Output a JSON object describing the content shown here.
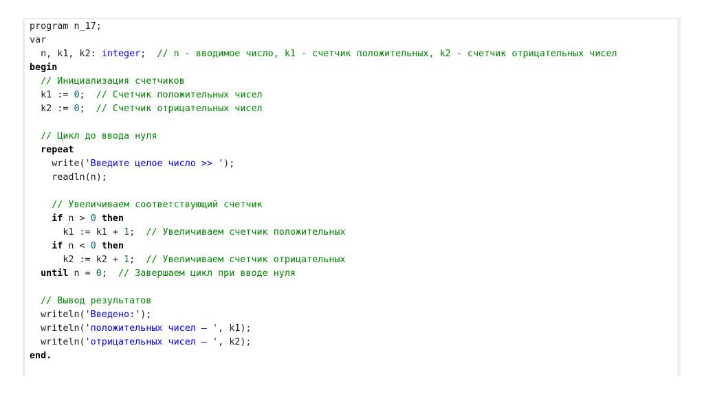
{
  "editor": {
    "lines": [
      [
        {
          "t": "program n_17;",
          "c": "tx"
        }
      ],
      [
        {
          "t": "var",
          "c": "tx"
        }
      ],
      [
        {
          "t": "  n, k1, k2: ",
          "c": "tx"
        },
        {
          "t": "integer",
          "c": "ty"
        },
        {
          "t": ";  ",
          "c": "tx"
        },
        {
          "t": "// n - вводимое число, k1 - счетчик положительных, k2 - счетчик отрицательных чисел",
          "c": "cm"
        }
      ],
      [
        {
          "t": "begin",
          "c": "kw"
        }
      ],
      [
        {
          "t": "  ",
          "c": "tx"
        },
        {
          "t": "// Инициализация счетчиков",
          "c": "cm"
        }
      ],
      [
        {
          "t": "  k1 := ",
          "c": "tx"
        },
        {
          "t": "0",
          "c": "nm"
        },
        {
          "t": ";  ",
          "c": "tx"
        },
        {
          "t": "// Счетчик положительных чисел",
          "c": "cm"
        }
      ],
      [
        {
          "t": "  k2 := ",
          "c": "tx"
        },
        {
          "t": "0",
          "c": "nm"
        },
        {
          "t": ";  ",
          "c": "tx"
        },
        {
          "t": "// Счетчик отрицательных чисел",
          "c": "cm"
        }
      ],
      [],
      [
        {
          "t": "  ",
          "c": "tx"
        },
        {
          "t": "// Цикл до ввода нуля",
          "c": "cm"
        }
      ],
      [
        {
          "t": "  ",
          "c": "tx"
        },
        {
          "t": "repeat",
          "c": "kw"
        }
      ],
      [
        {
          "t": "    write(",
          "c": "tx"
        },
        {
          "t": "'Введите целое число >> '",
          "c": "st"
        },
        {
          "t": ");",
          "c": "tx"
        }
      ],
      [
        {
          "t": "    readln(n);",
          "c": "tx"
        }
      ],
      [],
      [
        {
          "t": "    ",
          "c": "tx"
        },
        {
          "t": "// Увеличиваем соответствующий счетчик",
          "c": "cm"
        }
      ],
      [
        {
          "t": "    ",
          "c": "tx"
        },
        {
          "t": "if",
          "c": "kw"
        },
        {
          "t": " n > ",
          "c": "tx"
        },
        {
          "t": "0",
          "c": "nm"
        },
        {
          "t": " ",
          "c": "tx"
        },
        {
          "t": "then",
          "c": "kw"
        }
      ],
      [
        {
          "t": "      k1 := k1 + ",
          "c": "tx"
        },
        {
          "t": "1",
          "c": "nm"
        },
        {
          "t": ";  ",
          "c": "tx"
        },
        {
          "t": "// Увеличиваем счетчик положительных",
          "c": "cm"
        }
      ],
      [
        {
          "t": "    ",
          "c": "tx"
        },
        {
          "t": "if",
          "c": "kw"
        },
        {
          "t": " n < ",
          "c": "tx"
        },
        {
          "t": "0",
          "c": "nm"
        },
        {
          "t": " ",
          "c": "tx"
        },
        {
          "t": "then",
          "c": "kw"
        }
      ],
      [
        {
          "t": "      k2 := k2 + ",
          "c": "tx"
        },
        {
          "t": "1",
          "c": "nm"
        },
        {
          "t": ";  ",
          "c": "tx"
        },
        {
          "t": "// Увеличиваем счетчик отрицательных",
          "c": "cm"
        }
      ],
      [
        {
          "t": "  ",
          "c": "tx"
        },
        {
          "t": "until",
          "c": "kw"
        },
        {
          "t": " n = ",
          "c": "tx"
        },
        {
          "t": "0",
          "c": "nm"
        },
        {
          "t": ";  ",
          "c": "tx"
        },
        {
          "t": "// Завершаем цикл при вводе нуля",
          "c": "cm"
        }
      ],
      [],
      [
        {
          "t": "  ",
          "c": "tx"
        },
        {
          "t": "// Вывод результатов",
          "c": "cm"
        }
      ],
      [
        {
          "t": "  writeln(",
          "c": "tx"
        },
        {
          "t": "'Введено:'",
          "c": "st"
        },
        {
          "t": ");",
          "c": "tx"
        }
      ],
      [
        {
          "t": "  writeln(",
          "c": "tx"
        },
        {
          "t": "'положительных чисел – '",
          "c": "st"
        },
        {
          "t": ", k1);",
          "c": "tx"
        }
      ],
      [
        {
          "t": "  writeln(",
          "c": "tx"
        },
        {
          "t": "'отрицательных чисел – '",
          "c": "st"
        },
        {
          "t": ", k2);",
          "c": "tx"
        }
      ],
      [
        {
          "t": "end.",
          "c": "kw"
        }
      ]
    ]
  }
}
